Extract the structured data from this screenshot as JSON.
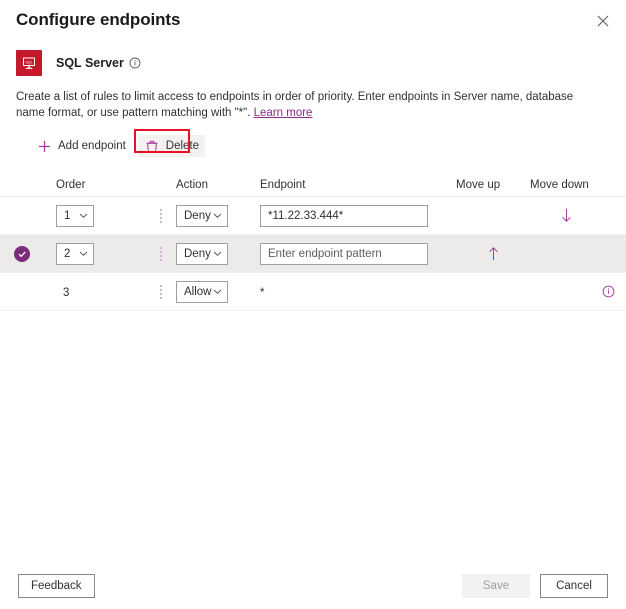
{
  "dialog": {
    "title": "Configure endpoints",
    "close_icon": "close-icon"
  },
  "resource": {
    "icon": "sql-server-icon",
    "name": "SQL Server",
    "info_icon": "info-icon"
  },
  "description": {
    "text": "Create a list of rules to limit access to endpoints in order of priority. Enter endpoints in Server name, database name format, or use pattern matching with \"*\". ",
    "link_label": "Learn more"
  },
  "command_bar": {
    "add_label": "Add endpoint",
    "add_icon": "plus-icon",
    "delete_label": "Delete",
    "delete_icon": "trash-icon",
    "annotation_color": "#e81123"
  },
  "table": {
    "columns": {
      "order": "Order",
      "action": "Action",
      "endpoint": "Endpoint",
      "move_up": "Move up",
      "move_down": "Move down"
    },
    "rows": [
      {
        "selected": false,
        "order": "1",
        "action": "Deny",
        "endpoint_value": "*11.22.33.444*",
        "endpoint_placeholder": "Enter endpoint pattern",
        "move_up": false,
        "move_down": true,
        "info": false
      },
      {
        "selected": true,
        "order": "2",
        "action": "Deny",
        "endpoint_value": "",
        "endpoint_placeholder": "Enter endpoint pattern",
        "move_up": true,
        "move_down": false,
        "info": false
      },
      {
        "selected": false,
        "order": "3",
        "action": "Allow",
        "endpoint_value": "*",
        "endpoint_placeholder": "",
        "move_up": false,
        "move_down": false,
        "info": true
      }
    ]
  },
  "footer": {
    "feedback_label": "Feedback",
    "save_label": "Save",
    "cancel_label": "Cancel",
    "save_disabled": true
  },
  "colors": {
    "accent_purple": "#a4379a",
    "selected_check": "#7b2d7b",
    "sql_red": "#c4192b",
    "annotation_red": "#e81123",
    "link": "#8a2b8a"
  }
}
